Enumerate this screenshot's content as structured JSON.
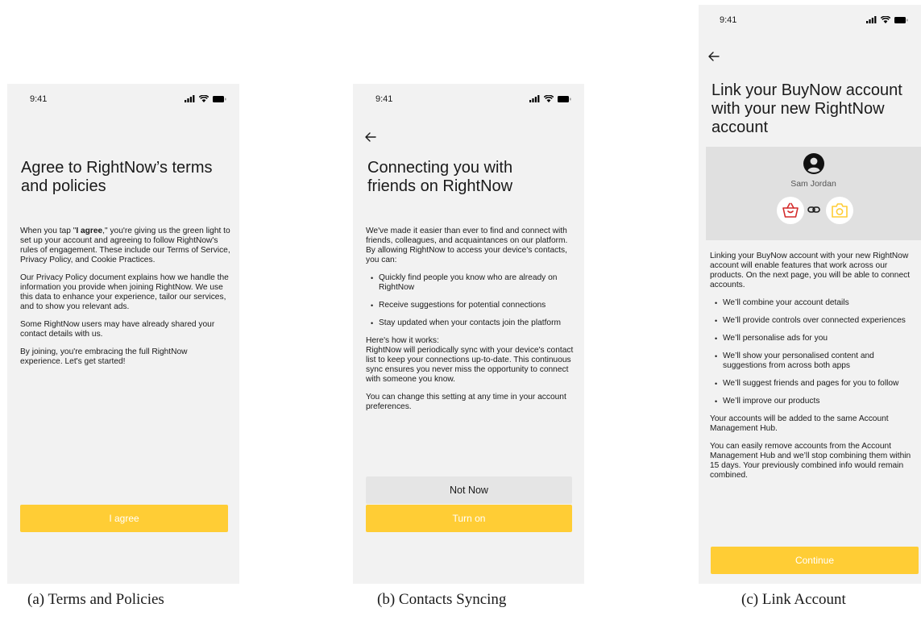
{
  "screens": {
    "terms": {
      "status_time": "9:41",
      "title": "Agree to RightNow’s terms and policies",
      "p1_pre": "When you tap \"",
      "p1_bold": "I agree",
      "p1_post": ",\" you're giving us the green light to set up your account and agreeing to follow RightNow's rules of engagement. These include our Terms of Service, Privacy Policy, and Cookie Practices.",
      "p2": "Our Privacy Policy document explains how we handle the information you provide when joining RightNow. We use this data to enhance your experience, tailor our services, and to show you relevant ads.",
      "p3": "Some RightNow users may have already shared your contact details with us.",
      "p4": "By joining, you're embracing the full RightNow experience. Let's get started!",
      "agree_label": "I agree"
    },
    "contacts": {
      "status_time": "9:41",
      "title": "Connecting you with friends on RightNow",
      "intro": "We've made it easier than ever to find and connect with friends, colleagues, and acquaintances on our platform. By allowing RightNow to access your device's contacts, you can:",
      "bullets": [
        "Quickly find people you know who are already on RightNow",
        "Receive suggestions for potential connections",
        "Stay updated when your contacts join the platform"
      ],
      "how_heading": "Here's how it works:",
      "how_body": "RightNow will periodically sync with your device's contact list to keep your connections up-to-date. This continuous sync ensures you never miss the opportunity to connect with someone you know.",
      "footer_note": "You can change this setting at any time in your account preferences.",
      "not_now_label": "Not Now",
      "turn_on_label": "Turn on"
    },
    "link": {
      "status_time": "9:41",
      "title": "Link your BuyNow account with your new RightNow account",
      "user_name": "Sam Jordan",
      "intro": "Linking your BuyNow account with your new RightNow account will enable features that work across our products. On the next page, you will be able to connect accounts.",
      "bullets": [
        "We’ll combine your account details",
        "We’ll provide controls over connected experiences",
        "We’ll personalise ads for you",
        "We’ll show your personalised content and suggestions from across both apps",
        "We’ll suggest friends and pages for you to follow",
        "We’ll improve our products"
      ],
      "p_hub": "Your accounts will be added to the same Account Management Hub.",
      "p_remove": "You can easily remove accounts from the Account Management Hub and we’ll stop combining them within 15 days. Your previously combined info would remain combined.",
      "continue_label": "Continue"
    }
  },
  "captions": {
    "a": "(a) Terms and Policies",
    "b": "(b) Contacts Syncing",
    "c": "(c) Link Account"
  },
  "icons": {
    "back": "arrow-left-icon",
    "avatar": "user-circle-icon",
    "buynow": "basket-icon",
    "rightnow": "camera-icon",
    "link": "link-icon"
  },
  "colors": {
    "accent": "#ffcd35",
    "screen_bg": "#f2f2f2",
    "card_bg": "#e0e0e0",
    "secondary_button": "#e5e5e5",
    "basket_red": "#d42a2a"
  }
}
